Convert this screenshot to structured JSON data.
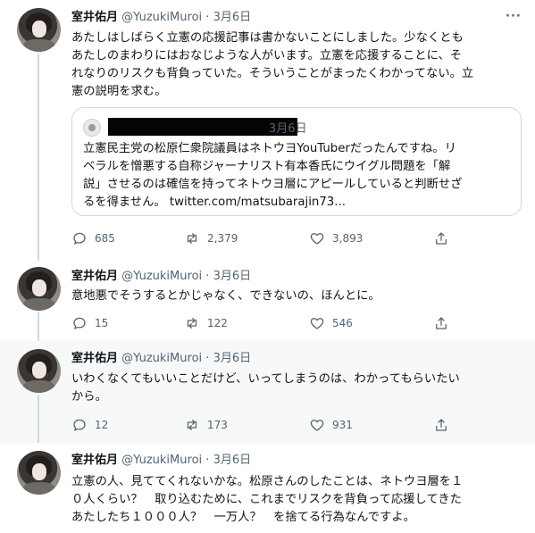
{
  "tweets": [
    {
      "name": "室井佑月",
      "handle": "@YuzukiMuroi",
      "dot": "·",
      "date": "3月6日",
      "text_lines": [
        "あたしはしばらく立憲の応援記事は書かないことにしました。少なくとも",
        "あたしのまわりにはおなじような人がいます。立憲を応援することに、そ",
        "れなりのリスクも背負っていた。そういうことがまったくわかってない。立",
        "憲の説明を求む。"
      ],
      "quote": {
        "date": "3月6日",
        "text_lines": [
          "立憲民主党の松原仁衆院議員はネトウヨYouTuberだったんですね。リ",
          "ベラルを憎悪する自称ジャーナリスト有本香氏にウイグル問題を「解",
          "説」させるのは確信を持ってネトウヨ層にアピールしていると判断せざ",
          "るを得ません。 twitter.com/matsubarajin73..."
        ]
      },
      "stats": {
        "replies": "685",
        "retweets": "2,379",
        "likes": "3,893"
      }
    },
    {
      "name": "室井佑月",
      "handle": "@YuzukiMuroi",
      "dot": "·",
      "date": "3月6日",
      "text_lines": [
        "意地悪でそうするとかじゃなく、できないの、ほんとに。"
      ],
      "stats": {
        "replies": "15",
        "retweets": "122",
        "likes": "546"
      }
    },
    {
      "name": "室井佑月",
      "handle": "@YuzukiMuroi",
      "dot": "·",
      "date": "3月6日",
      "text_lines": [
        "いわくなくてもいいことだけど、いってしまうのは、わかってもらいたい",
        "から。"
      ],
      "stats": {
        "replies": "12",
        "retweets": "173",
        "likes": "931"
      }
    },
    {
      "name": "室井佑月",
      "handle": "@YuzukiMuroi",
      "dot": "·",
      "date": "3月6日",
      "text_lines": [
        "立憲の人、見ててくれないかな。松原さんのしたことは、ネトウヨ層を１",
        "０人くらい？　取り込むために、これまでリスクを背負って応援してきた",
        "あたしたち１０００人？　一万人？　を捨てる行為なんですよ。"
      ]
    }
  ],
  "icons": {
    "reply": "speech-bubble-icon",
    "retweet": "retweet-icon",
    "like": "heart-icon",
    "share": "share-icon",
    "more": "more-dots-icon"
  },
  "colors": {
    "text": "#0f1419",
    "secondary": "#536471",
    "border": "#cfd9de",
    "highlight_bg": "#f7f9f9"
  }
}
